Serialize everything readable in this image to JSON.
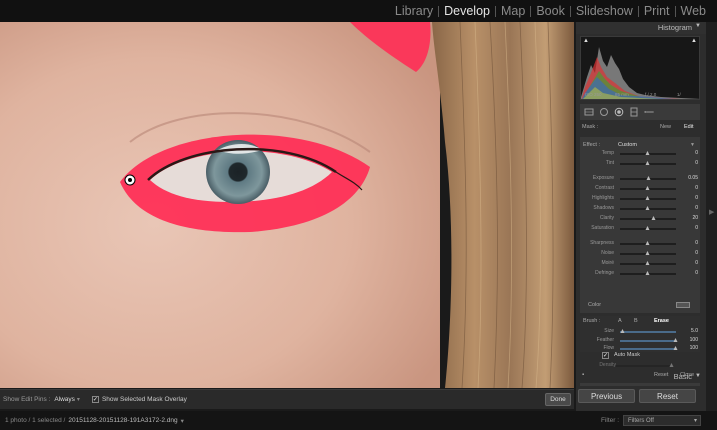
{
  "modules": [
    "Library",
    "Develop",
    "Map",
    "Book",
    "Slideshow",
    "Print",
    "Web"
  ],
  "active_module": "Develop",
  "toolbar": {
    "show_edit_pins_label": "Show Edit Pins :",
    "show_edit_pins_value": "Always",
    "show_mask_overlay_label": "Show Selected Mask Overlay",
    "show_mask_overlay_checked": "✓",
    "done_label": "Done"
  },
  "statusbar": {
    "photo_count": "1 photo / 1 selected /",
    "filename": "20151128-20151128-191A3172-2.dng",
    "filter_label": "Filter :",
    "filter_value": "Filters Off"
  },
  "histogram": {
    "title": "Histogram",
    "iso": "ISO 250",
    "focal": "85 mm",
    "aperture": "f / 2.0",
    "shutter": "1/"
  },
  "mask": {
    "label": "Mask :",
    "new": "New",
    "edit": "Edit"
  },
  "effect": {
    "label": "Effect :",
    "preset": "Custom",
    "rows": [
      {
        "label": "Temp",
        "value": "0",
        "pos": 0.5
      },
      {
        "label": "Tint",
        "value": "0",
        "pos": 0.5
      },
      {
        "label": "Exposure",
        "value": "0.05",
        "pos": 0.52
      },
      {
        "label": "Contrast",
        "value": "0",
        "pos": 0.5
      },
      {
        "label": "Highlights",
        "value": "0",
        "pos": 0.5
      },
      {
        "label": "Shadows",
        "value": "0",
        "pos": 0.5
      },
      {
        "label": "Clarity",
        "value": "20",
        "pos": 0.6
      },
      {
        "label": "Saturation",
        "value": "0",
        "pos": 0.5
      },
      {
        "label": "Sharpness",
        "value": "0",
        "pos": 0.5
      },
      {
        "label": "Noise",
        "value": "0",
        "pos": 0.5
      },
      {
        "label": "Moiré",
        "value": "0",
        "pos": 0.5
      },
      {
        "label": "Defringe",
        "value": "0",
        "pos": 0.5
      }
    ],
    "color_label": "Color"
  },
  "brush": {
    "label": "Brush :",
    "a": "A",
    "b": "B",
    "erase": "Erase",
    "rows": [
      {
        "label": "Size",
        "value": "5.0",
        "pos": 0.05
      },
      {
        "label": "Feather",
        "value": "100",
        "pos": 1.0
      },
      {
        "label": "Flow",
        "value": "100",
        "pos": 1.0
      }
    ],
    "auto_mask_label": "Auto Mask",
    "auto_mask_checked": "✓",
    "density_label": "Density"
  },
  "reset_row": {
    "reset": "Reset",
    "close": "Close"
  },
  "basic": {
    "title": "Basic"
  },
  "buttons": {
    "previous": "Previous",
    "reset": "Reset"
  },
  "colors": {
    "mask_overlay": "#ff2d55",
    "panel_bg": "#2d2d2d"
  }
}
